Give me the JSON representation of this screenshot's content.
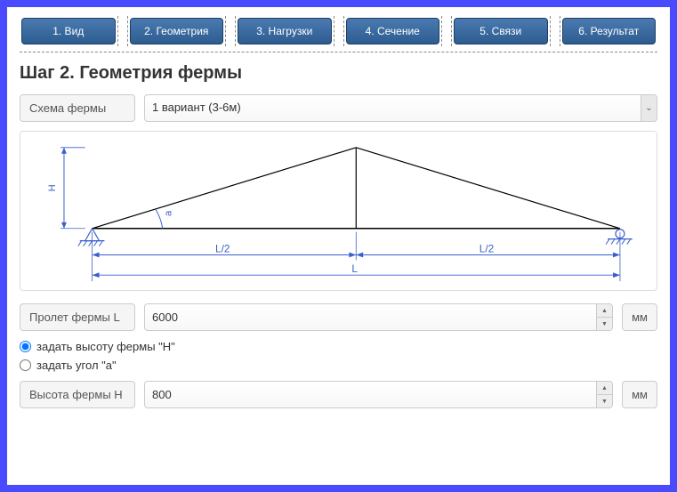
{
  "tabs": {
    "t1": "1. Вид",
    "t2": "2. Геометрия",
    "t3": "3. Нагрузки",
    "t4": "4. Сечение",
    "t5": "5. Связи",
    "t6": "6. Результат"
  },
  "heading": "Шаг 2. Геометрия фермы",
  "scheme": {
    "label": "Схема фермы",
    "selected": "1 вариант (3-6м)"
  },
  "diagram": {
    "H": "H",
    "a": "a",
    "L2a": "L/2",
    "L2b": "L/2",
    "L": "L"
  },
  "span": {
    "label": "Пролет фермы L",
    "value": "6000",
    "unit": "мм"
  },
  "radios": {
    "byHeight": "задать высоту фермы \"H\"",
    "byAngle": "задать угол \"a\""
  },
  "height": {
    "label": "Высота фермы H",
    "value": "800",
    "unit": "мм"
  }
}
